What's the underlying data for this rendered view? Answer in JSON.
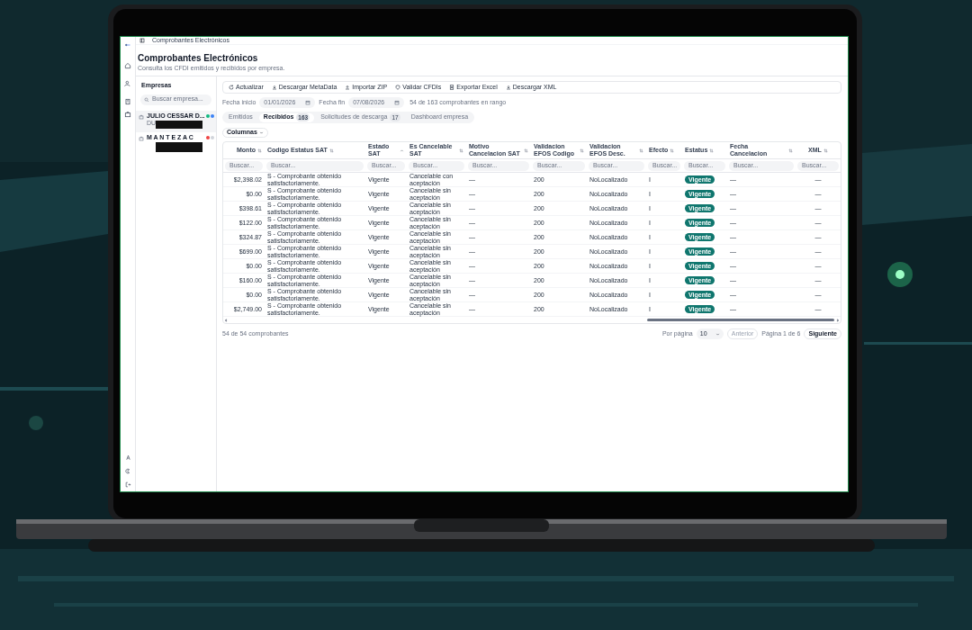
{
  "topbar": {
    "title": "Comprobantes Electrónicos"
  },
  "header": {
    "title": "Comprobantes Electrónicos",
    "subtitle": "Consulta los CFDI emitidos y recibidos por empresa."
  },
  "companies_panel": {
    "title": "Empresas",
    "search_placeholder": "Buscar empresa...",
    "items": [
      {
        "name": "JULIO CESSAR D...",
        "subtitle": "DU",
        "selected": true,
        "dots": [
          {
            "color": "#10b981"
          },
          {
            "color": "#3b82f6"
          }
        ]
      },
      {
        "name": "M A N T E Z A C",
        "selected": false,
        "dots": [
          {
            "color": "#ef4444"
          },
          {
            "color": "#d1d5db"
          }
        ]
      }
    ]
  },
  "toolbar": [
    "Actualizar",
    "Descargar MetaData",
    "Importar ZIP",
    "Validar CFDIs",
    "Exportar Excel",
    "Descargar XML"
  ],
  "date_filter": {
    "start_label": "Fecha inicio",
    "start": "01/01/2026",
    "end_label": "Fecha fin",
    "end": "07/08/2026",
    "range_info": "54 de 163 comprobantes en rango"
  },
  "tabs": [
    {
      "label": "Emitidos",
      "selected": false
    },
    {
      "label": "Recibidos",
      "count": "163",
      "selected": true
    },
    {
      "label": "Solicitudes de descarga",
      "count": "17",
      "selected": false
    },
    {
      "label": "Dashboard empresa",
      "selected": false
    }
  ],
  "columns_button": "Columnas",
  "table": {
    "columns": [
      {
        "label": "Monto",
        "sorted_ascending": false,
        "filter_placeholder": "Buscar..."
      },
      {
        "label": "Codigo Estatus SAT",
        "sorted_ascending": false,
        "filter_placeholder": "Buscar..."
      },
      {
        "label": "Estado SAT",
        "sorted_ascending": true,
        "filter_placeholder": "Buscar..."
      },
      {
        "label": "Es Cancelable SAT",
        "sorted_ascending": false,
        "filter_placeholder": "Buscar..."
      },
      {
        "label": "Motivo Cancelacion SAT",
        "sorted_ascending": false,
        "filter_placeholder": "Buscar..."
      },
      {
        "label": "Validacion EFOS Codigo",
        "sorted_ascending": false,
        "filter_placeholder": "Buscar..."
      },
      {
        "label": "Validacion EFOS Desc.",
        "sorted_ascending": false,
        "filter_placeholder": "Buscar..."
      },
      {
        "label": "Efecto",
        "sorted_ascending": false,
        "filter_placeholder": "Buscar..."
      },
      {
        "label": "Estatus",
        "sorted_ascending": false,
        "filter_placeholder": "Buscar..."
      },
      {
        "label": "Fecha Cancelacion",
        "sorted_ascending": false,
        "filter_placeholder": "Buscar..."
      },
      {
        "label": "XML",
        "sorted_ascending": false,
        "filter_placeholder": "Buscar..."
      }
    ],
    "rows": [
      [
        "$2,398.02",
        "S - Comprobante obtenido satisfactoriamente.",
        "Vigente",
        "Cancelable con aceptación",
        "—",
        "200",
        "NoLocalizado",
        "I",
        "Vigente",
        "—",
        "—"
      ],
      [
        "$0.00",
        "S - Comprobante obtenido satisfactoriamente.",
        "Vigente",
        "Cancelable sin aceptación",
        "—",
        "200",
        "NoLocalizado",
        "I",
        "Vigente",
        "—",
        "—"
      ],
      [
        "$398.61",
        "S - Comprobante obtenido satisfactoriamente.",
        "Vigente",
        "Cancelable sin aceptación",
        "—",
        "200",
        "NoLocalizado",
        "I",
        "Vigente",
        "—",
        "—"
      ],
      [
        "$122.00",
        "S - Comprobante obtenido satisfactoriamente.",
        "Vigente",
        "Cancelable sin aceptación",
        "—",
        "200",
        "NoLocalizado",
        "I",
        "Vigente",
        "—",
        "—"
      ],
      [
        "$324.87",
        "S - Comprobante obtenido satisfactoriamente.",
        "Vigente",
        "Cancelable sin aceptación",
        "—",
        "200",
        "NoLocalizado",
        "I",
        "Vigente",
        "—",
        "—"
      ],
      [
        "$699.00",
        "S - Comprobante obtenido satisfactoriamente.",
        "Vigente",
        "Cancelable sin aceptación",
        "—",
        "200",
        "NoLocalizado",
        "I",
        "Vigente",
        "—",
        "—"
      ],
      [
        "$0.00",
        "S - Comprobante obtenido satisfactoriamente.",
        "Vigente",
        "Cancelable sin aceptación",
        "—",
        "200",
        "NoLocalizado",
        "I",
        "Vigente",
        "—",
        "—"
      ],
      [
        "$160.00",
        "S - Comprobante obtenido satisfactoriamente.",
        "Vigente",
        "Cancelable sin aceptación",
        "—",
        "200",
        "NoLocalizado",
        "I",
        "Vigente",
        "—",
        "—"
      ],
      [
        "$0.00",
        "S - Comprobante obtenido satisfactoriamente.",
        "Vigente",
        "Cancelable sin aceptación",
        "—",
        "200",
        "NoLocalizado",
        "I",
        "Vigente",
        "—",
        "—"
      ],
      [
        "$2,749.00",
        "S - Comprobante obtenido satisfactoriamente.",
        "Vigente",
        "Cancelable sin aceptación",
        "—",
        "200",
        "NoLocalizado",
        "I",
        "Vigente",
        "—",
        "—"
      ]
    ]
  },
  "footer": {
    "total": "54 de 54 comprobantes",
    "per_page_label": "Por página",
    "per_page": "10",
    "prev": {
      "label": "Anterior",
      "disabled": true
    },
    "page_info": "Página 1 de 6",
    "next": {
      "label": "Siguiente",
      "disabled": false
    }
  }
}
